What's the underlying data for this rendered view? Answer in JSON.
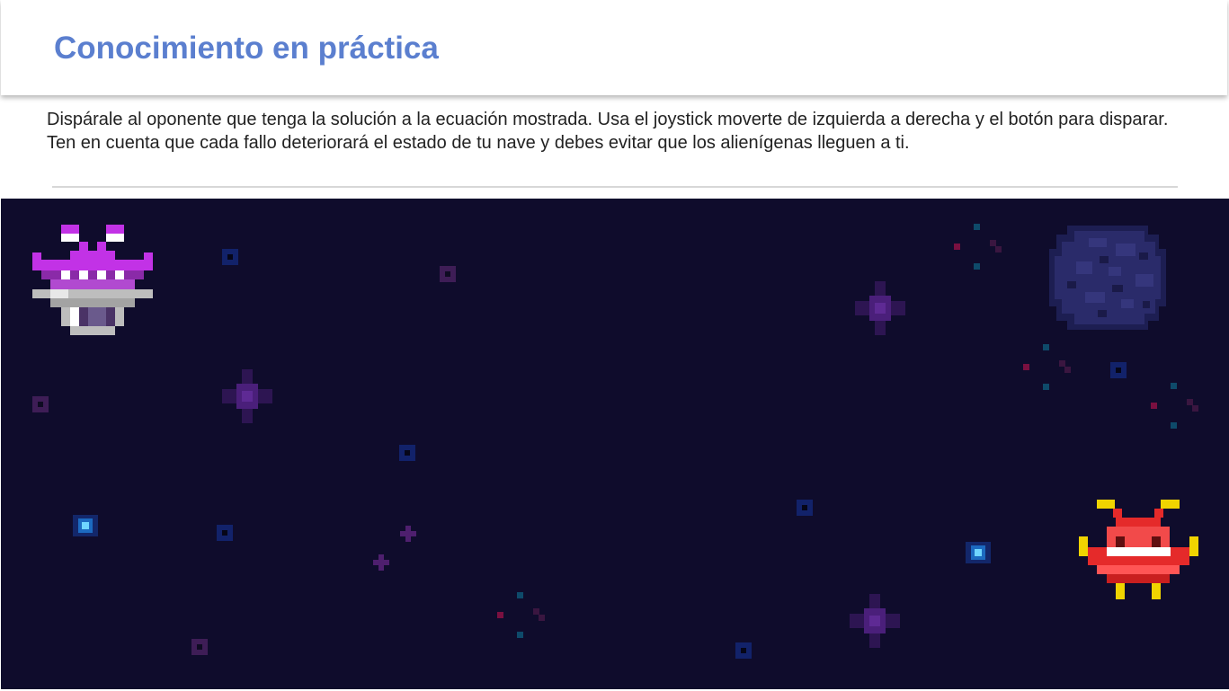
{
  "page": {
    "title": "Conocimiento en práctica",
    "instructions": "Dispárale al oponente que tenga la solución a la ecuación mostrada. Usa el joystick moverte de izquierda a derecha y el botón para disparar. Ten en cuenta que cada fallo deteriorará el estado de tu nave y debes evitar que los alienígenas lleguen a ti."
  },
  "game": {
    "background_color": "#0f0c2c",
    "sprites": [
      {
        "name": "purple-alien-ufo-icon",
        "color": "#c232e6"
      },
      {
        "name": "red-alien-invader-icon",
        "color": "#e52a2a"
      },
      {
        "name": "planet-icon",
        "color": "#2a2b6a"
      }
    ]
  },
  "colors": {
    "title": "#5b7fcf",
    "text": "#222222",
    "divider": "#d7d7d7"
  }
}
